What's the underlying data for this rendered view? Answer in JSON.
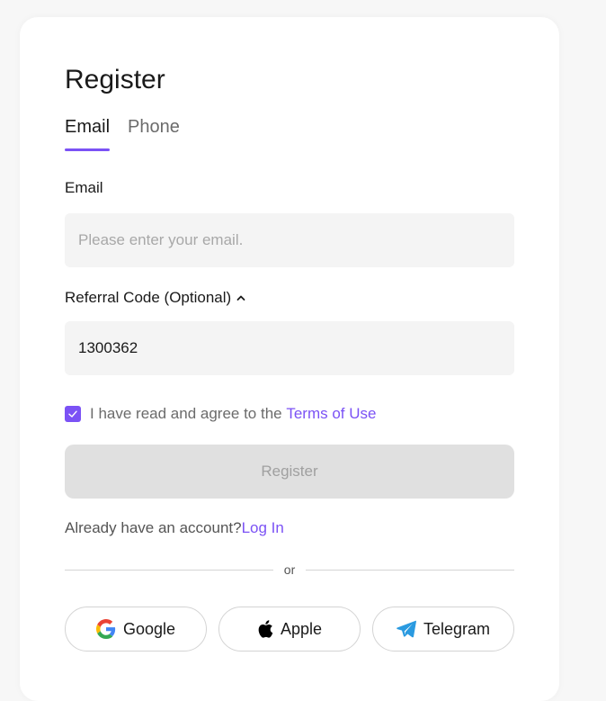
{
  "colors": {
    "accent": "#7b52f5",
    "field_bg": "#f4f4f4",
    "button_disabled": "#e0e0e0"
  },
  "title": "Register",
  "tabs": [
    {
      "label": "Email",
      "active": true
    },
    {
      "label": "Phone",
      "active": false
    }
  ],
  "email": {
    "label": "Email",
    "placeholder": "Please enter your email.",
    "value": ""
  },
  "referral": {
    "label": "Referral Code (Optional)",
    "icon": "chevron-up-icon",
    "value": "1300362"
  },
  "agreement": {
    "checked": true,
    "text": "I have read and agree to the ",
    "link": "Terms of Use"
  },
  "register_button": "Register",
  "login": {
    "text": "Already have an account?",
    "link": "Log In"
  },
  "divider_text": "or",
  "socials": [
    {
      "label": "Google",
      "icon": "google-icon"
    },
    {
      "label": "Apple",
      "icon": "apple-icon"
    },
    {
      "label": "Telegram",
      "icon": "telegram-icon"
    }
  ]
}
